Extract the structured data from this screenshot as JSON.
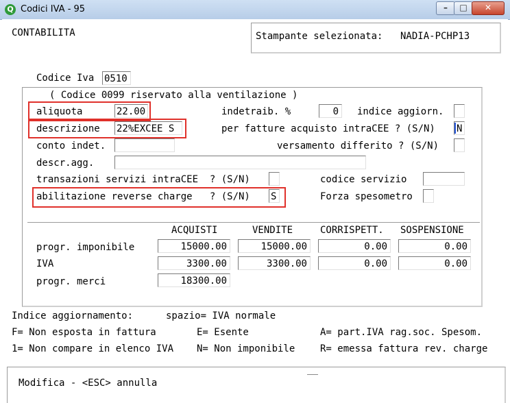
{
  "window": {
    "title": "Codici IVA - 95",
    "app_icon": "Q"
  },
  "header": {
    "section": "CONTABILITA",
    "printer_label": "Stampante selezionata:",
    "printer_name": "NADIA-PCHP13"
  },
  "codice": {
    "label": "Codice Iva",
    "value": "0510",
    "note": "( Codice 0099 riservato alla ventilazione )"
  },
  "form": {
    "aliquota": {
      "label": "aliquota",
      "value": "22.00"
    },
    "indetraib": {
      "label": "indetraib. %",
      "value": "0"
    },
    "indice_aggiorn": {
      "label": "indice aggiorn.",
      "value": ""
    },
    "descrizione": {
      "label": "descrizione",
      "value": "22%EXCEE S"
    },
    "fatture_intracee": {
      "label": "per fatture acquisto intraCEE ? (S/N)",
      "value": "N"
    },
    "conto_indet": {
      "label": "conto indet.",
      "value": ""
    },
    "versamento_differito": {
      "label": "versamento differito ? (S/N)",
      "value": ""
    },
    "descr_agg": {
      "label": "descr.agg.",
      "value": ""
    },
    "transazioni_servizi": {
      "label": "transazioni servizi intraCEE  ? (S/N)",
      "value": ""
    },
    "codice_servizio": {
      "label": "codice servizio",
      "value": ""
    },
    "reverse_charge": {
      "label": "abilitazione reverse charge   ? (S/N)",
      "value": "S"
    },
    "forza_spesometro": {
      "label": "Forza spesometro",
      "value": ""
    }
  },
  "totals": {
    "columns": [
      "ACQUISTI",
      "VENDITE",
      "CORRISPETT.",
      "SOSPENSIONE"
    ],
    "rows": [
      {
        "label": "progr. imponibile",
        "values": [
          "15000.00",
          "15000.00",
          "0.00",
          "0.00"
        ]
      },
      {
        "label": "IVA",
        "values": [
          "3300.00",
          "3300.00",
          "0.00",
          "0.00"
        ]
      },
      {
        "label": "progr. merci",
        "values": [
          "18300.00"
        ]
      }
    ]
  },
  "legend": {
    "title": "Indice aggiornamento:",
    "title_desc": "spazio= IVA normale",
    "items": [
      "F= Non esposta in fattura",
      "E= Esente",
      "A= part.IVA rag.soc. Spesom.",
      "1= Non compare in elenco IVA",
      "N= Non imponibile",
      "R= emessa fattura rev. charge"
    ]
  },
  "status": {
    "text": "Modifica - <ESC> annulla"
  },
  "icons": {
    "minimize": "minimize-icon",
    "maximize": "maximize-icon",
    "close": "close-icon"
  }
}
